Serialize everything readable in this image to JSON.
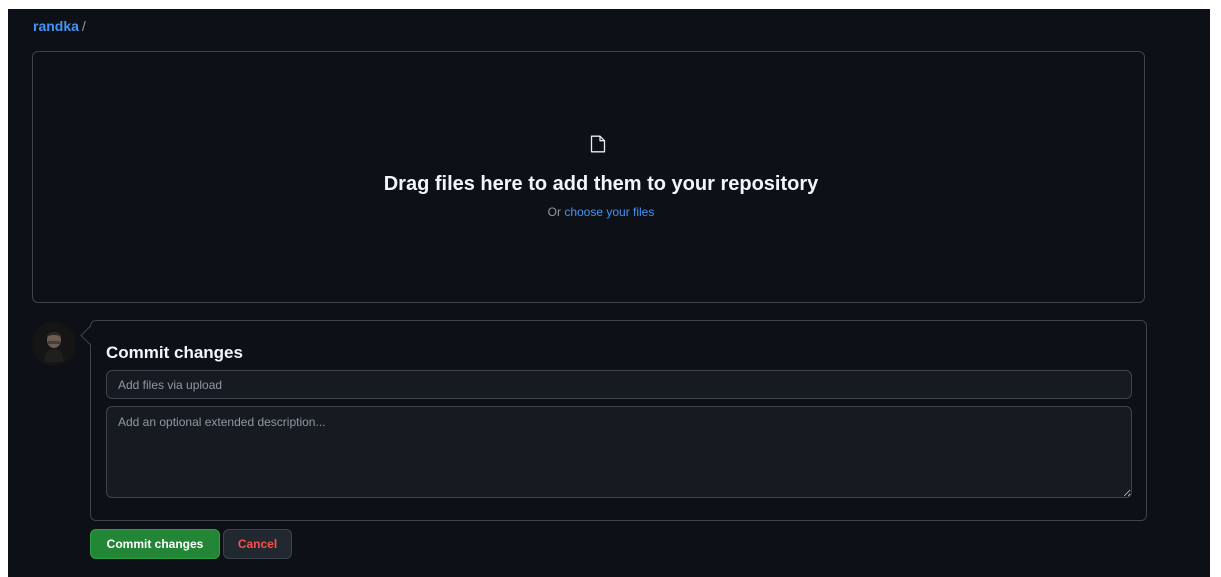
{
  "breadcrumb": {
    "owner": "randka",
    "separator": "/"
  },
  "dropzone": {
    "icon": "file-icon",
    "title": "Drag files here to add them to your repository",
    "or_text": "Or",
    "choose_link": "choose your files"
  },
  "commit": {
    "title": "Commit changes",
    "summary": {
      "value": "",
      "placeholder": "Add files via upload"
    },
    "description": {
      "value": "",
      "placeholder": "Add an optional extended description..."
    },
    "commit_button": "Commit changes",
    "cancel_button": "Cancel"
  },
  "colors": {
    "background": "#0d1117",
    "link": "#4493f8",
    "commit_green": "#238636",
    "cancel_red": "#f85149",
    "border": "#3d444d"
  }
}
